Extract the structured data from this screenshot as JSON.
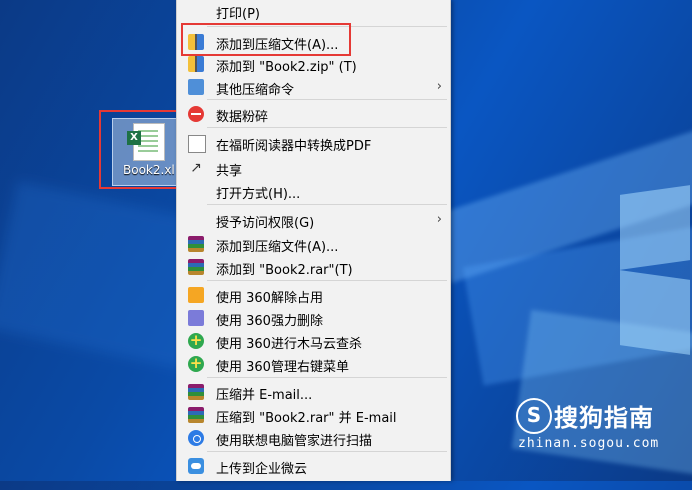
{
  "desktop": {
    "file_label": "Book2.xl",
    "file_badge": "X"
  },
  "menu": {
    "items": [
      {
        "label": "打印(P)"
      },
      {
        "label": "添加到压缩文件(A)..."
      },
      {
        "label": "添加到 \"Book2.zip\" (T)"
      },
      {
        "label": "其他压缩命令"
      },
      {
        "label": "数据粉碎"
      },
      {
        "label": "在福昕阅读器中转换成PDF"
      },
      {
        "label": "共享"
      },
      {
        "label": "打开方式(H)..."
      },
      {
        "label": "授予访问权限(G)"
      },
      {
        "label": "添加到压缩文件(A)..."
      },
      {
        "label": "添加到 \"Book2.rar\"(T)"
      },
      {
        "label": "使用 360解除占用"
      },
      {
        "label": "使用 360强力删除"
      },
      {
        "label": "使用 360进行木马云查杀"
      },
      {
        "label": "使用 360管理右键菜单"
      },
      {
        "label": "压缩并 E-mail..."
      },
      {
        "label": "压缩到 \"Book2.rar\" 并 E-mail"
      },
      {
        "label": "使用联想电脑管家进行扫描"
      },
      {
        "label": "上传到企业微云"
      }
    ],
    "submenu_arrow": "›"
  },
  "watermark": {
    "logo_glyph": "S",
    "name": "搜狗指南",
    "url": "zhinan.sogou.com"
  },
  "colors": {
    "highlight_box": "#e53935",
    "menu_bg": "#f2f2f2"
  }
}
